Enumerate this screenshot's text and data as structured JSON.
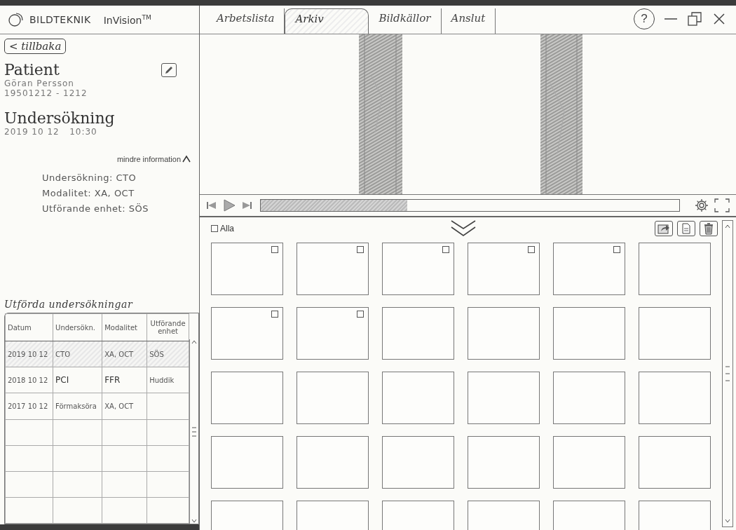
{
  "logo": {
    "brand": "BILDTEKNIK",
    "product": "InVision",
    "mark": "TM"
  },
  "back_button": {
    "label": "< tillbaka"
  },
  "patient": {
    "heading": "Patient",
    "name": "Göran Persson",
    "id": "19501212 - 1212"
  },
  "examination": {
    "heading": "Undersökning",
    "datetime": "2019 10 12   10:30"
  },
  "less_info": {
    "label": "mindre information",
    "expanded": true
  },
  "details": [
    "Undersökning: CTO",
    "Modalitet: XA, OCT",
    "Utförande enhet: SÖS"
  ],
  "history": {
    "title": "Utförda undersökningar",
    "columns": [
      "Datum",
      "Undersökn.",
      "Modalitet",
      "Utförande enhet"
    ],
    "rows": [
      {
        "cells": [
          "2019 10 12",
          "CTO",
          "XA, OCT",
          "SÖS"
        ],
        "selected": true
      },
      {
        "cells": [
          "2018 10 12",
          "PCI",
          "FFR",
          "Huddik"
        ],
        "selected": false
      },
      {
        "cells": [
          "2017 10 12",
          "Förmaksöra",
          "XA, OCT"
        ],
        "selected": false
      }
    ]
  },
  "tabs": [
    {
      "label": "Arbetslista",
      "selected": false
    },
    {
      "label": "Arkiv",
      "selected": true
    },
    {
      "label": "Bildkällor",
      "selected": false
    },
    {
      "label": "Anslut",
      "selected": false
    }
  ],
  "help": {
    "label": "?"
  },
  "player": {
    "level": 0.35
  },
  "gallery": {
    "select_all": {
      "label": "Alla",
      "checked": false
    },
    "thumbnails": [
      [
        {
          "kind": "checkable",
          "checked": false
        },
        {
          "kind": "checkable",
          "checked": false
        },
        {
          "kind": "checkable",
          "checked": false
        },
        {
          "kind": "checkable",
          "checked": false
        },
        {
          "kind": "checkable",
          "checked": false
        },
        {
          "kind": "plain"
        }
      ],
      [
        {
          "kind": "checkable",
          "checked": false
        },
        {
          "kind": "checkable",
          "checked": false
        },
        {
          "kind": "plain"
        },
        {
          "kind": "plain"
        },
        {
          "kind": "plain"
        },
        {
          "kind": "plain"
        }
      ],
      [
        {
          "kind": "plain"
        },
        {
          "kind": "plain"
        },
        {
          "kind": "plain"
        },
        {
          "kind": "plain"
        },
        {
          "kind": "plain"
        },
        {
          "kind": "plain"
        }
      ],
      [
        {
          "kind": "plain"
        },
        {
          "kind": "plain"
        },
        {
          "kind": "plain"
        },
        {
          "kind": "plain"
        },
        {
          "kind": "plain"
        },
        {
          "kind": "plain"
        }
      ],
      [
        {
          "kind": "plain"
        },
        {
          "kind": "plain"
        },
        {
          "kind": "plain"
        },
        {
          "kind": "plain"
        },
        {
          "kind": "plain"
        },
        {
          "kind": "plain"
        }
      ]
    ]
  }
}
